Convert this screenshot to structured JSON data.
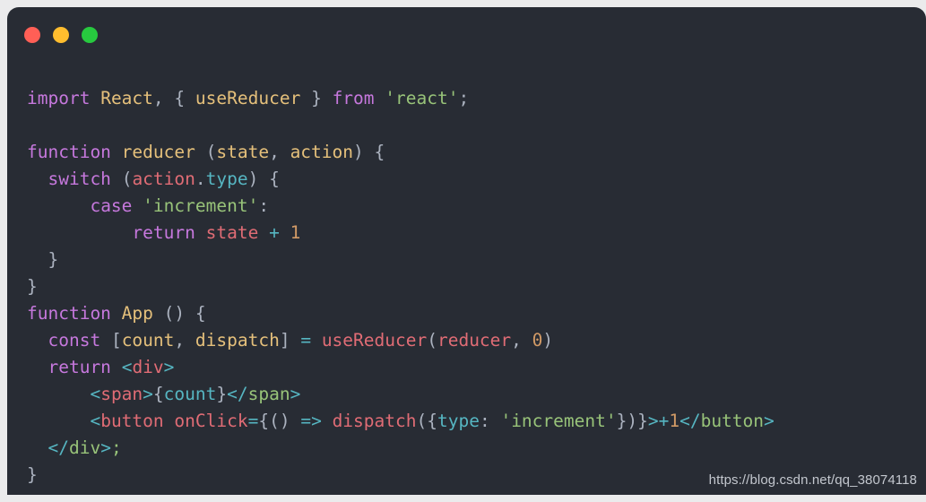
{
  "window": {
    "traffic_lights": [
      {
        "name": "close-button",
        "label": "Close",
        "color": "#ff5f56"
      },
      {
        "name": "minimize-button",
        "label": "Minimize",
        "color": "#ffbd2e"
      },
      {
        "name": "maximize-button",
        "label": "Maximize",
        "color": "#27c93f"
      }
    ]
  },
  "theme": {
    "background": "#282c34",
    "page_background": "#ebebec",
    "keyword": "#c678dd",
    "function_name": "#e5c07b",
    "punctuation": "#abb2bf",
    "string": "#98c379",
    "variable": "#e06c75",
    "property": "#56b6c2",
    "number": "#d19a66"
  },
  "code": {
    "language": "jsx",
    "lines": [
      {
        "n": 1,
        "text": "import React, { useReducer } from 'react';"
      },
      {
        "n": 2,
        "text": ""
      },
      {
        "n": 3,
        "text": "function reducer (state, action) {"
      },
      {
        "n": 4,
        "text": "  switch (action.type) {"
      },
      {
        "n": 5,
        "text": "      case 'increment':"
      },
      {
        "n": 6,
        "text": "          return state + 1"
      },
      {
        "n": 7,
        "text": "  }"
      },
      {
        "n": 8,
        "text": "}"
      },
      {
        "n": 9,
        "text": "function App () {"
      },
      {
        "n": 10,
        "text": "  const [count, dispatch] = useReducer(reducer, 0)"
      },
      {
        "n": 11,
        "text": "  return <div>"
      },
      {
        "n": 12,
        "text": "      <span>{count}</span>"
      },
      {
        "n": 13,
        "text": "      <button onClick={() => dispatch({type: 'increment'})}>+1</button>"
      },
      {
        "n": 14,
        "text": "  </div>;"
      },
      {
        "n": 15,
        "text": "}"
      }
    ],
    "tokens": {
      "l1": {
        "import": "import",
        "react_default": "React",
        "comma": ",",
        "brace_open": "{",
        "use_reducer": "useReducer",
        "brace_close": "}",
        "from": "from",
        "module": "'react'",
        "semi": ";"
      },
      "l3": {
        "function": "function",
        "name": "reducer",
        "paren_open": "(",
        "p1": "state",
        "comma": ",",
        "p2": "action",
        "paren_close": ")",
        "brace": "{"
      },
      "l4": {
        "switch": "switch",
        "paren_open": "(",
        "obj": "action",
        "dot": ".",
        "prop": "type",
        "paren_close": ")",
        "brace": "{"
      },
      "l5": {
        "case": "case",
        "value": "'increment'",
        "colon": ":"
      },
      "l6": {
        "return": "return",
        "ident": "state",
        "op": "+",
        "num": "1"
      },
      "l7": {
        "brace": "}"
      },
      "l8": {
        "brace": "}"
      },
      "l9": {
        "function": "function",
        "name": "App",
        "parens": "()",
        "brace": "{"
      },
      "l10": {
        "const": "const",
        "bracket_open": "[",
        "v1": "count",
        "comma": ",",
        "v2": "dispatch",
        "bracket_close": "]",
        "assign": "=",
        "call": "useReducer",
        "paren_open": "(",
        "arg1": "reducer",
        "comma2": ",",
        "arg2": "0",
        "paren_close": ")"
      },
      "l11": {
        "return": "return",
        "lt": "<",
        "tag": "div",
        "gt": ">"
      },
      "l12": {
        "lt": "<",
        "tag": "span",
        "gt": ">",
        "brace_open": "{",
        "expr": "count",
        "brace_close": "}",
        "close_lt": "</",
        "close_tag": "span",
        "close_gt": ">"
      },
      "l13": {
        "lt": "<",
        "tag": "button",
        "attr": "onClick",
        "assign": "=",
        "brace_open": "{",
        "parens": "()",
        "arrow": "=>",
        "call": "dispatch",
        "paren_open": "(",
        "obj_open": "{",
        "key": "type",
        "colon": ":",
        "val": "'increment'",
        "obj_close": "}",
        "paren_close": ")",
        "brace_close": "}",
        "gt": ">",
        "op": "+",
        "num": "1",
        "close_lt": "</",
        "close_tag": "button",
        "close_gt": ">"
      },
      "l14": {
        "close_lt": "</",
        "close_tag": "div",
        "close_gt": ">",
        "semi": ";"
      },
      "l15": {
        "brace": "}"
      }
    }
  },
  "watermark": {
    "text": "https://blog.csdn.net/qq_38074118"
  }
}
